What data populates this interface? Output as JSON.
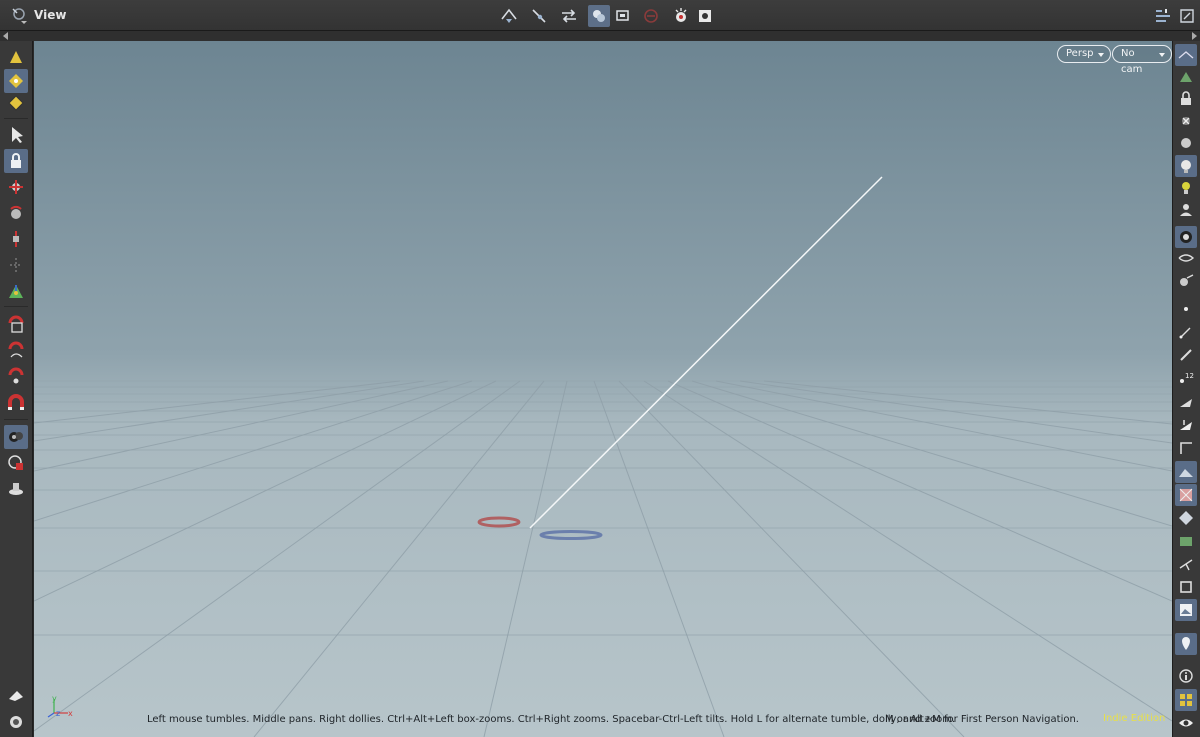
{
  "pane": {
    "title": "View"
  },
  "viewport": {
    "perspective_menu": "Persp",
    "camera_menu": "No cam",
    "status_text": "Left mouse tumbles. Middle pans. Right dollies. Ctrl+Alt+Left box-zooms. Ctrl+Right zooms. Spacebar-Ctrl-Left tilts. Hold L for alternate tumble, dolly, and zoom.",
    "status_text_2": "M or Alt+M for First Person Navigation.",
    "edition_label": "Indie Edition",
    "axis_labels": {
      "x": "x",
      "y": "y",
      "z": "z"
    }
  },
  "colors": {
    "viewport_top": "#6d8592",
    "viewport_bottom": "#b7c5ca",
    "toolbar_bg": "#393939",
    "active_tool": "#5a6d88",
    "edition_text": "#e8e048",
    "grid_line": "#8c9ca4"
  },
  "icons": {
    "top": [
      "pane-menu-icon",
      "snap-icon",
      "select-mode-icon",
      "transform-icon",
      "ghost-icon",
      "zoom-icon",
      "no-entry-icon",
      "lights-icon",
      "settings-icon",
      "layout-icon"
    ],
    "left": [
      "paint-brush-icon",
      "select-points-icon",
      "select-prims-icon",
      "select-arrow-icon",
      "lock-icon",
      "move-tool-icon",
      "rotate-tool-icon",
      "scale-tool-icon",
      "pose-tool-icon",
      "handle-tool-icon",
      "snap-grid-icon",
      "snap-curve-icon",
      "snap-point-icon",
      "magnet-icon",
      "view-tool-icon",
      "render-region-icon",
      "flipbook-icon",
      "display-options-icon",
      "camera-icon"
    ],
    "right": [
      "wireframe-icon",
      "shaded-icon",
      "lock-camera-icon",
      "xray-icon",
      "bounding-box-icon",
      "light-icon",
      "point-light-icon",
      "cam-icon",
      "show-geo-icon",
      "shading-icon",
      "guides-icon",
      "point-display-icon",
      "normals-icon",
      "attribute-icon",
      "point-numbers-icon",
      "prim-normals-icon",
      "frame-icon",
      "corner-icon",
      "background-icon",
      "texture-icon",
      "diamond-icon",
      "grid-display-icon",
      "measure-icon",
      "box-icon",
      "image-icon",
      "pin-icon",
      "info-icon",
      "quad-layout-icon",
      "eye-icon"
    ]
  }
}
